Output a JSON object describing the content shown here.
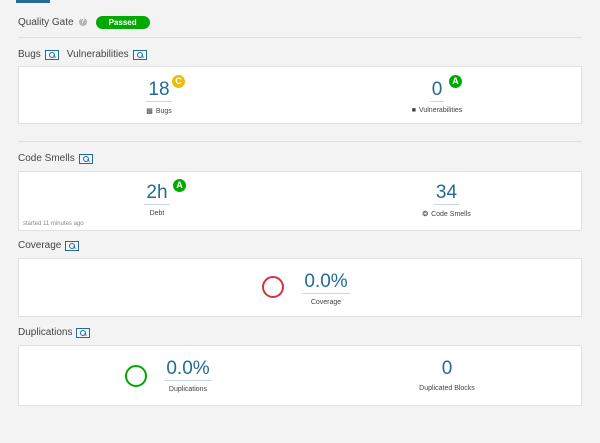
{
  "quality_gate": {
    "label": "Quality Gate",
    "status": "Passed"
  },
  "sections": {
    "bugs_vulns": {
      "bugs_title": "Bugs",
      "vulns_title": "Vulnerabilities"
    },
    "code_smells": {
      "title": "Code Smells"
    },
    "coverage": {
      "title": "Coverage"
    },
    "duplications": {
      "title": "Duplications"
    }
  },
  "metrics": {
    "bugs": {
      "value": "18",
      "rating": "C",
      "label": "Bugs"
    },
    "vulnerabilities": {
      "value": "0",
      "rating": "A",
      "label": "Vulnerabilities"
    },
    "debt": {
      "value": "2h",
      "rating": "A",
      "label": "Debt"
    },
    "code_smells": {
      "value": "34",
      "label": "Code Smells"
    },
    "coverage": {
      "value": "0.0%",
      "label": "Coverage"
    },
    "duplications": {
      "value": "0.0%",
      "label": "Duplications"
    },
    "duplicated_blocks": {
      "value": "0",
      "label": "Duplicated Blocks"
    }
  },
  "started": "started 11 minutes ago",
  "colors": {
    "accent": "#236a97",
    "passed": "#00aa00",
    "rating_c": "#eabe06",
    "rating_a": "#00aa00",
    "coverage_ring": "#d4333f",
    "duplication_ring": "#00aa00"
  }
}
